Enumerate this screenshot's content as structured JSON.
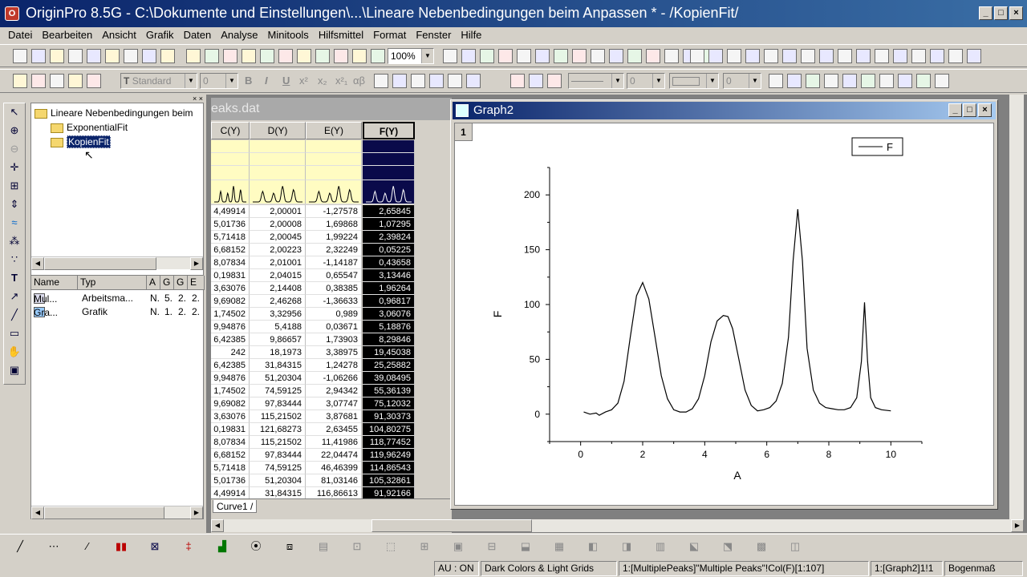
{
  "window": {
    "title": "OriginPro 8.5G - C:\\Dokumente und Einstellungen\\...\\Lineare Nebenbedingungen beim Anpassen * - /KopienFit/",
    "min": "_",
    "max": "□",
    "close": "×"
  },
  "menu": [
    "Datei",
    "Bearbeiten",
    "Ansicht",
    "Grafik",
    "Daten",
    "Analyse",
    "Minitools",
    "Hilfsmittel",
    "Format",
    "Fenster",
    "Hilfe"
  ],
  "toolbar": {
    "zoom": "100%",
    "font_name": "Standard",
    "font_size": "0",
    "bold": "B",
    "italic": "I",
    "underline": "U",
    "superscript": "x²",
    "subscript": "x₂",
    "supsub": "x²₁",
    "greek": "αβ",
    "line_style": "",
    "line_width": "0",
    "fill_width": "0"
  },
  "tree": {
    "root": "Lineare Nebenbedingungen beim",
    "children": [
      "ExponentialFit",
      "KopienFit"
    ],
    "selected": "KopienFit"
  },
  "filelist": {
    "headers": [
      "Name",
      "Typ",
      "A",
      "G",
      "G",
      "E"
    ],
    "rows": [
      {
        "name": "Mul...",
        "type": "Arbeitsma...",
        "a": "N.",
        "g1": "5.",
        "g2": "2.",
        "e": "2."
      },
      {
        "name": "Gra...",
        "type": "Grafik",
        "a": "N.",
        "g1": "1.",
        "g2": "2.",
        "e": "2."
      }
    ]
  },
  "workbook": {
    "title": "eaks.dat",
    "headers": [
      "C(Y)",
      "D(Y)",
      "E(Y)",
      "F(Y)"
    ],
    "rows": [
      [
        "4,49914",
        "2,00001",
        "-1,27578",
        "2,65845"
      ],
      [
        "5,01736",
        "2,00008",
        "1,69868",
        "1,07295"
      ],
      [
        "5,71418",
        "2,00045",
        "1,99224",
        "2,39824"
      ],
      [
        "6,68152",
        "2,00223",
        "2,32249",
        "0,05225"
      ],
      [
        "8,07834",
        "2,01001",
        "-1,14187",
        "0,43658"
      ],
      [
        "0,19831",
        "2,04015",
        "0,65547",
        "3,13446"
      ],
      [
        "3,63076",
        "2,14408",
        "0,38385",
        "1,96264"
      ],
      [
        "9,69082",
        "2,46268",
        "-1,36633",
        "0,96817"
      ],
      [
        "1,74502",
        "3,32956",
        "0,989",
        "3,06076"
      ],
      [
        "9,94876",
        "5,4188",
        "0,03671",
        "5,18876"
      ],
      [
        "6,42385",
        "9,86657",
        "1,73903",
        "8,29846"
      ],
      [
        "242",
        "18,1973",
        "3,38975",
        "19,45038"
      ],
      [
        "6,42385",
        "31,84315",
        "1,24278",
        "25,25882"
      ],
      [
        "9,94876",
        "51,20304",
        "-1,06266",
        "39,08495"
      ],
      [
        "1,74502",
        "74,59125",
        "2,94342",
        "55,36139"
      ],
      [
        "9,69082",
        "97,83444",
        "3,07747",
        "75,12032"
      ],
      [
        "3,63076",
        "115,21502",
        "3,87681",
        "91,30373"
      ],
      [
        "0,19831",
        "121,68273",
        "2,63455",
        "104,80275"
      ],
      [
        "8,07834",
        "115,21502",
        "11,41986",
        "118,77452"
      ],
      [
        "6,68152",
        "97,83444",
        "22,04474",
        "119,96249"
      ],
      [
        "5,71418",
        "74,59125",
        "46,46399",
        "114,86543"
      ],
      [
        "5,01736",
        "51,20304",
        "81,03146",
        "105,32861"
      ],
      [
        "4,49914",
        "31,84315",
        "116,86613",
        "91,92166"
      ]
    ],
    "sheet_tab": "Curve1"
  },
  "graph": {
    "title": "Graph2",
    "layer": "1",
    "legend": "F"
  },
  "chart_data": {
    "type": "line",
    "xlabel": "A",
    "ylabel": "F",
    "xlim": [
      -1,
      11
    ],
    "ylim": [
      -25,
      225
    ],
    "xticks": [
      0,
      2,
      4,
      6,
      8,
      10
    ],
    "yticks": [
      0,
      50,
      100,
      150,
      200
    ],
    "series": [
      {
        "name": "F",
        "x": [
          0.1,
          0.3,
          0.5,
          0.6,
          0.8,
          1.0,
          1.2,
          1.4,
          1.6,
          1.8,
          2.0,
          2.2,
          2.4,
          2.6,
          2.8,
          3.0,
          3.2,
          3.4,
          3.6,
          3.8,
          4.0,
          4.2,
          4.4,
          4.6,
          4.75,
          4.9,
          5.1,
          5.3,
          5.5,
          5.7,
          5.9,
          6.1,
          6.3,
          6.5,
          6.7,
          6.85,
          7.0,
          7.15,
          7.3,
          7.5,
          7.7,
          7.9,
          8.1,
          8.3,
          8.5,
          8.7,
          8.9,
          9.05,
          9.15,
          9.25,
          9.35,
          9.5,
          9.7,
          10.0
        ],
        "y": [
          2,
          0,
          1,
          -1,
          2,
          4,
          10,
          30,
          70,
          108,
          120,
          105,
          70,
          35,
          14,
          4,
          2,
          2,
          5,
          14,
          35,
          66,
          85,
          90,
          89,
          78,
          50,
          22,
          8,
          3,
          4,
          6,
          12,
          28,
          70,
          140,
          187,
          140,
          60,
          22,
          10,
          6,
          5,
          4,
          4,
          6,
          15,
          48,
          102,
          48,
          15,
          6,
          4,
          3
        ]
      }
    ]
  },
  "status": {
    "au": "AU : ON",
    "theme": "Dark Colors & Light Grids",
    "col": "1:[MultiplePeaks]\"Multiple Peaks\"!Col(F)[1:107]",
    "graph": "1:[Graph2]1!1",
    "angle": "Bogenmaß"
  }
}
